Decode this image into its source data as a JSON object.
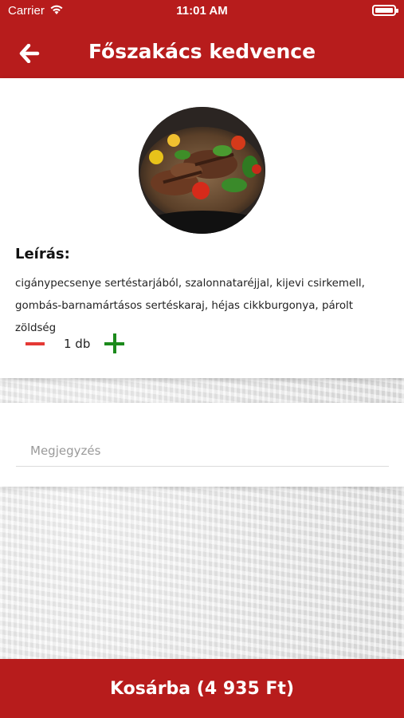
{
  "status_bar": {
    "carrier": "Carrier",
    "time": "11:01 AM",
    "wifi_icon": "wifi-icon",
    "battery_icon": "battery-icon"
  },
  "header": {
    "title": "Főszakács kedvence",
    "back_icon": "arrow-left-icon",
    "background_color": "#b71c1c"
  },
  "dish": {
    "image": "grilled-meat-with-vegetables-photo",
    "description_heading": "Leírás:",
    "description_line_1": "cigánypecsenye sertéstarjából, szalonnataréjjal, kijevi csirkemell,",
    "description_line_2": "gombás-barnamártásos sertéskaraj, héjas cikkburgonya, párolt zöldség"
  },
  "quantity": {
    "value": "1 db",
    "minus_color": "#e53935",
    "plus_color": "#1b8a1b"
  },
  "note": {
    "placeholder": "Megjegyzés",
    "value": ""
  },
  "cart": {
    "button_label": "Kosárba (4 935 Ft)"
  }
}
